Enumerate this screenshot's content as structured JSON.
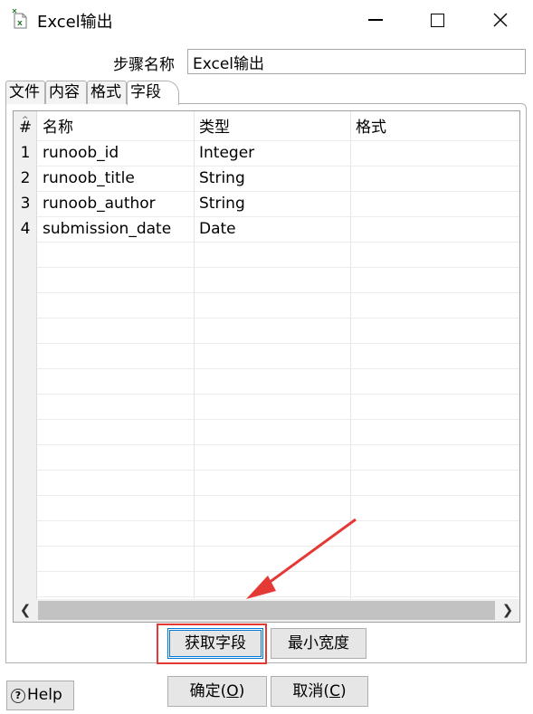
{
  "window": {
    "title": "Excel输出",
    "icon": "excel-output-icon"
  },
  "step_name": {
    "label": "步骤名称",
    "value": "Excel输出"
  },
  "tabs": [
    {
      "label": "文件"
    },
    {
      "label": "内容"
    },
    {
      "label": "格式"
    },
    {
      "label": "字段",
      "active": true
    }
  ],
  "table": {
    "columns": [
      "#",
      "名称",
      "类型",
      "格式"
    ],
    "rows": [
      {
        "idx": "1",
        "name": "runoob_id",
        "type": "Integer",
        "format": ""
      },
      {
        "idx": "2",
        "name": "runoob_title",
        "type": "String",
        "format": ""
      },
      {
        "idx": "3",
        "name": "runoob_author",
        "type": "String",
        "format": ""
      },
      {
        "idx": "4",
        "name": "submission_date",
        "type": "Date",
        "format": ""
      }
    ]
  },
  "buttons": {
    "get_fields": "获取字段",
    "min_width": "最小宽度",
    "ok_main": "确定(",
    "ok_key": "O",
    "ok_end": ")",
    "cancel_main": "取消(",
    "cancel_key": "C",
    "cancel_end": ")",
    "help": "Help"
  },
  "colors": {
    "annotation": "#e53935",
    "focus": "#0078d7"
  }
}
